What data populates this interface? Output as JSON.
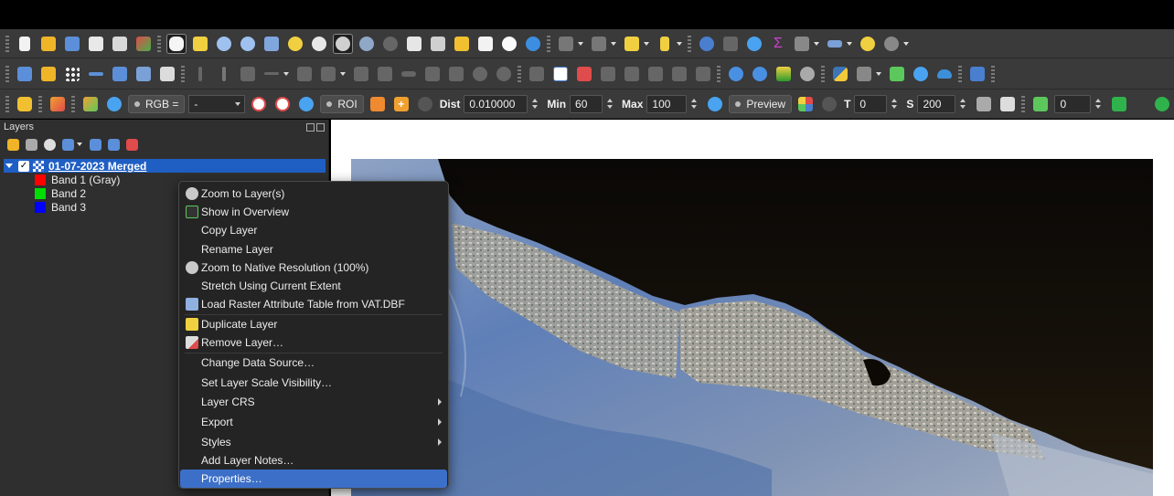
{
  "toolbar3": {
    "rgb_combo": "RGB =",
    "band_select": "-",
    "roi_combo": "ROI",
    "dist_label": "Dist",
    "dist_value": "0.010000",
    "min_label": "Min",
    "min_value": "60",
    "max_label": "Max",
    "max_value": "100",
    "preview_combo": "Preview",
    "t_label": "T",
    "t_value": "0",
    "s_label": "S",
    "s_value": "200",
    "last_value": "0"
  },
  "layers_panel": {
    "title": "Layers",
    "layer": {
      "name": "01-07-2023 Merged",
      "checked": "✓"
    },
    "bands": [
      {
        "label": "Band 1 (Gray)",
        "color": "#ff0000"
      },
      {
        "label": "Band 2",
        "color": "#00dd00"
      },
      {
        "label": "Band 3",
        "color": "#0000ff"
      }
    ]
  },
  "context_menu": {
    "items": [
      {
        "label": "Zoom to Layer(s)",
        "icon": "zoom-layer-icon"
      },
      {
        "label": "Show in Overview",
        "icon": "overview-icon"
      },
      {
        "label": "Copy Layer"
      },
      {
        "label": "Rename Layer"
      },
      {
        "label": "Zoom to Native Resolution (100%)",
        "icon": "zoom-native-icon"
      },
      {
        "label": "Stretch Using Current Extent"
      },
      {
        "label": "Load Raster Attribute Table from VAT.DBF",
        "icon": "table-icon"
      },
      {
        "label": "Duplicate Layer",
        "icon": "duplicate-icon"
      },
      {
        "label": "Remove Layer…",
        "icon": "remove-icon"
      },
      {
        "label": "Change Data Source…"
      },
      {
        "label": "Set Layer Scale Visibility…"
      },
      {
        "label": "Layer CRS",
        "submenu": true
      },
      {
        "label": "Export",
        "submenu": true
      },
      {
        "label": "Styles",
        "submenu": true
      },
      {
        "label": "Add Layer Notes…"
      },
      {
        "label": "Properties…",
        "highlighted": true
      }
    ]
  },
  "colors": {
    "selection": "#1f5fc4",
    "menu_highlight": "#3c6fc7",
    "toolbar_bg": "#3a3a3a"
  }
}
